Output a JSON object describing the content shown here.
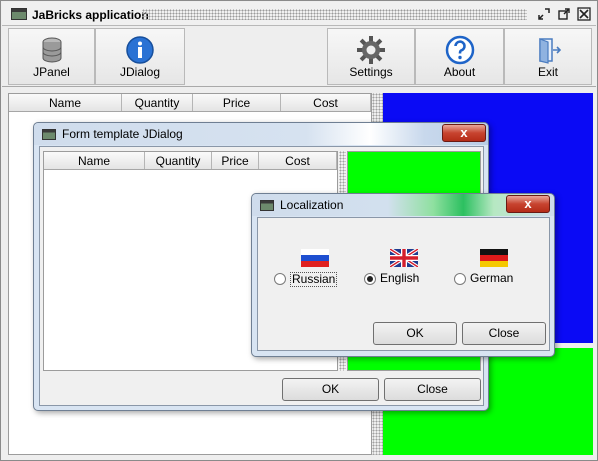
{
  "app": {
    "title": "JaBricks application"
  },
  "toolbar": {
    "buttons": [
      {
        "label": "JPanel",
        "icon": "database-icon"
      },
      {
        "label": "JDialog",
        "icon": "info-icon"
      },
      {
        "label": "Settings",
        "icon": "gear-icon"
      },
      {
        "label": "About",
        "icon": "question-icon"
      },
      {
        "label": "Exit",
        "icon": "exit-door-icon"
      }
    ]
  },
  "main_table": {
    "columns": [
      "Name",
      "Quantity",
      "Price",
      "Cost"
    ]
  },
  "form_dialog": {
    "title": "Form template JDialog",
    "close_label": "x",
    "columns": [
      "Name",
      "Quantity",
      "Price",
      "Cost"
    ],
    "ok_label": "OK",
    "close_button_label": "Close"
  },
  "localization_dialog": {
    "title": "Localization",
    "close_label": "x",
    "options": [
      {
        "label": "Russian",
        "selected": false,
        "icon": "russia-flag-icon"
      },
      {
        "label": "English",
        "selected": true,
        "icon": "uk-flag-icon"
      },
      {
        "label": "German",
        "selected": false,
        "icon": "germany-flag-icon"
      }
    ],
    "ok_label": "OK",
    "close_button_label": "Close"
  },
  "colors": {
    "blue_panel": "#0a0af5",
    "green_panel": "#00ff00",
    "close_button": "#c7432f"
  }
}
